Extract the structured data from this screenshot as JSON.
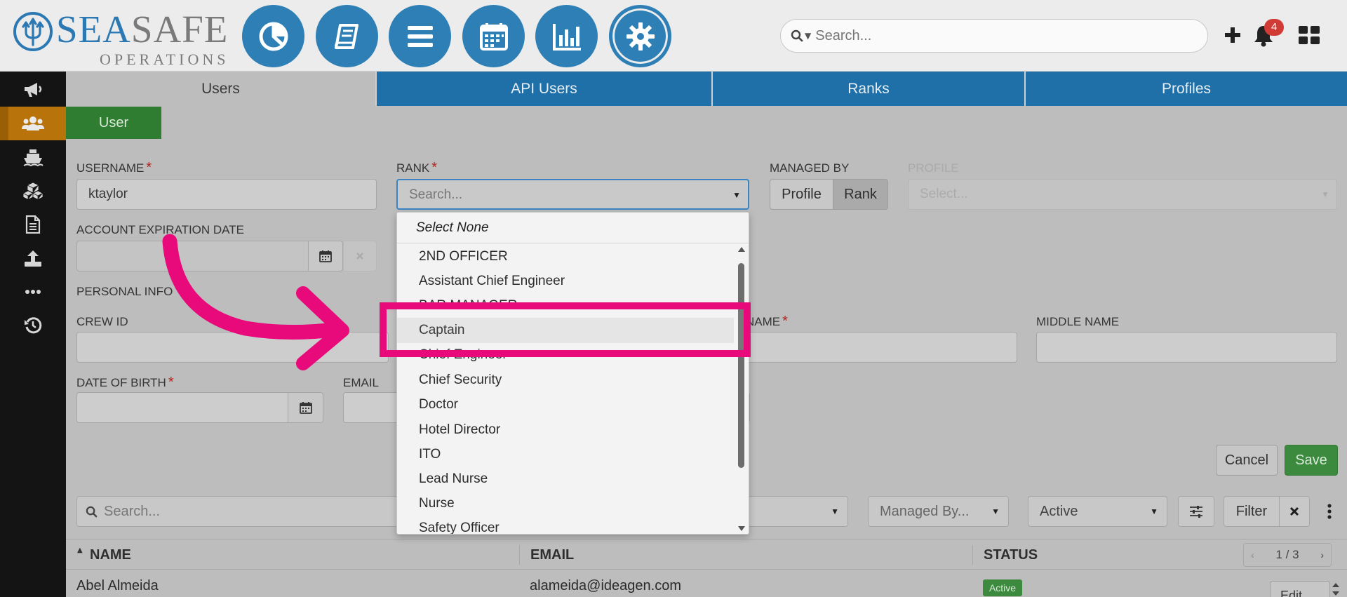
{
  "logo": {
    "word_part1": "SEA",
    "word_part2": "SAFE",
    "sub": "OPERATIONS"
  },
  "header": {
    "search_placeholder": "Search...",
    "notification_count": "4",
    "nav_icons": [
      "dashboard-pie-icon",
      "book-icon",
      "list-icon",
      "calendar-icon",
      "bar-chart-icon",
      "gear-icon"
    ]
  },
  "sidebar": {
    "items": [
      "megaphone-icon",
      "users-icon",
      "ship-icon",
      "boxes-icon",
      "document-icon",
      "upload-icon",
      "more-icon",
      "history-icon"
    ],
    "active_index": 1
  },
  "tabs": [
    {
      "label": "Users",
      "active": true
    },
    {
      "label": "API Users",
      "active": false
    },
    {
      "label": "Ranks",
      "active": false
    },
    {
      "label": "Profiles",
      "active": false
    }
  ],
  "subtab": "User",
  "form": {
    "username_label": "USERNAME",
    "username_value": "ktaylor",
    "rank_label": "RANK",
    "rank_placeholder": "Search...",
    "managed_by_label": "MANAGED BY",
    "managed_by_options": [
      "Profile",
      "Rank"
    ],
    "managed_by_selected": "Rank",
    "profile_label": "PROFILE",
    "profile_placeholder": "Select...",
    "account_expiration_label": "ACCOUNT EXPIRATION DATE",
    "personal_info_label": "PERSONAL INFO",
    "crew_id_label": "CREW ID",
    "last_name_label_fragment": "NAME",
    "middle_name_label": "MIDDLE NAME",
    "dob_label": "DATE OF BIRTH",
    "email_label": "EMAIL",
    "cancel_label": "Cancel",
    "save_label": "Save"
  },
  "rank_dropdown": {
    "select_none": "Select None",
    "options": [
      "2ND OFFICER",
      "Assistant Chief Engineer",
      "BAR MANAGER",
      "Captain",
      "Chief Engineer",
      "Chief Security",
      "Doctor",
      "Hotel Director",
      "ITO",
      "Lead Nurse",
      "Nurse",
      "Safety Officer"
    ],
    "highlighted": "Captain"
  },
  "filters": {
    "search_placeholder": "Search...",
    "managed_by_placeholder": "Managed By...",
    "status_value": "Active",
    "filter_label": "Filter"
  },
  "table": {
    "columns": [
      "NAME",
      "EMAIL",
      "STATUS"
    ],
    "pager": "1 / 3",
    "rows": [
      {
        "name": "Abel Almeida",
        "email": "alameida@ideagen.com",
        "status": "Active",
        "action": "Edit"
      }
    ]
  },
  "colors": {
    "brand_blue": "#2d7fb6",
    "tab_blue": "#1f6fa8",
    "green": "#3b8a3e",
    "sidebar_active": "#b8740a",
    "annotation_pink": "#e8097b"
  }
}
